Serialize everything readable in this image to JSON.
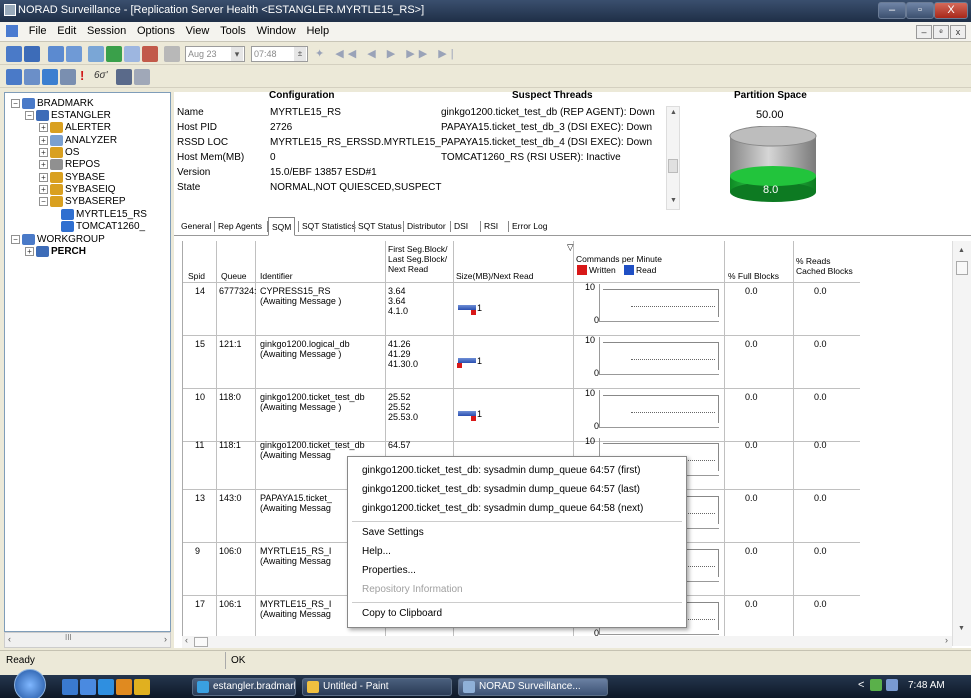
{
  "window": {
    "title": "NORAD Surveillance - [Replication Server Health <ESTANGLER.MYRTLE15_RS>]",
    "min": "–",
    "max": "▫",
    "close": "X"
  },
  "menu": {
    "items": [
      "File",
      "Edit",
      "Session",
      "Options",
      "View",
      "Tools",
      "Window",
      "Help"
    ],
    "mdi_buttons": [
      "–",
      "ᵉ",
      "x"
    ]
  },
  "toolbar": {
    "date": "Aug 23",
    "time": "07:48"
  },
  "tree": {
    "items": [
      {
        "label": "BRADMARK",
        "exp": "−"
      },
      {
        "label": "ESTANGLER",
        "exp": "−"
      },
      {
        "label": "ALERTER",
        "exp": "+"
      },
      {
        "label": "ANALYZER",
        "exp": "+"
      },
      {
        "label": "OS",
        "exp": "+"
      },
      {
        "label": "REPOS",
        "exp": "+"
      },
      {
        "label": "SYBASE",
        "exp": "+"
      },
      {
        "label": "SYBASEIQ",
        "exp": "+"
      },
      {
        "label": "SYBASEREP",
        "exp": "−"
      },
      {
        "label": "MYRTLE15_RS",
        "exp": ""
      },
      {
        "label": "TOMCAT1260_",
        "exp": ""
      },
      {
        "label": "WORKGROUP",
        "exp": "−"
      },
      {
        "label": "PERCH",
        "exp": "+"
      }
    ],
    "scroll": "III"
  },
  "config": {
    "header": "Configuration",
    "rows": [
      {
        "label": "Name",
        "value": "MYRTLE15_RS"
      },
      {
        "label": "Host PID",
        "value": "2726"
      },
      {
        "label": "RSSD LOC",
        "value": "MYRTLE15_RS_ERSSD.MYRTLE15_"
      },
      {
        "label": "Host Mem(MB)",
        "value": "0"
      },
      {
        "label": "Version",
        "value": "15.0/EBF 13857 ESD#1"
      },
      {
        "label": "State",
        "value": "NORMAL,NOT QUIESCED,SUSPECT"
      }
    ]
  },
  "suspect": {
    "header": "Suspect Threads",
    "rows": [
      "ginkgo1200.ticket_test_db (REP AGENT): Down",
      "PAPAYA15.ticket_test_db_3 (DSI EXEC): Down",
      "PAPAYA15.ticket_test_db_4 (DSI EXEC): Down",
      "TOMCAT1260_RS (RSI USER): Inactive"
    ]
  },
  "partition": {
    "header": "Partition Space",
    "total": "50.00",
    "used": "8.0"
  },
  "tabs": [
    "General",
    "Rep Agents",
    "SQM",
    "SQT Statistics",
    "SQT Status",
    "Distributor",
    "DSI",
    "RSI",
    "Error Log"
  ],
  "active_tab": "SQM",
  "grid": {
    "headers": {
      "spid": "Spid",
      "queue": "Queue",
      "identifier": "Identifier",
      "seg1": "First Seg.Block/",
      "seg2": "Last Seg.Block/",
      "seg3": "Next Read",
      "size": "Size(MB)/Next Read",
      "cpm": "Commands per Minute",
      "written": "Written",
      "read": "Read",
      "full": "% Full Blocks",
      "reads1": "% Reads",
      "reads2": "Cached Blocks"
    },
    "rows": [
      {
        "spid": "14",
        "queue": "6777324:",
        "ident": "CYPRESS15_RS",
        "status": "(Awaiting Message    )",
        "s1": "3.64",
        "s2": "3.64",
        "s3": "4.1.0",
        "size": "1",
        "tick": "10",
        "zero": "0",
        "full": "0.0",
        "reads": "0.0"
      },
      {
        "spid": "15",
        "queue": "121:1",
        "ident": "ginkgo1200.logical_db",
        "status": "(Awaiting Message    )",
        "s1": "41.26",
        "s2": "41.29",
        "s3": "41.30.0",
        "size": "1",
        "tick": "10",
        "zero": "0",
        "full": "0.0",
        "reads": "0.0"
      },
      {
        "spid": "10",
        "queue": "118:0",
        "ident": "ginkgo1200.ticket_test_db",
        "status": "(Awaiting Message    )",
        "s1": "25.52",
        "s2": "25.52",
        "s3": "25.53.0",
        "size": "1",
        "tick": "10",
        "zero": "0",
        "full": "0.0",
        "reads": "0.0"
      },
      {
        "spid": "11",
        "queue": "118:1",
        "ident": "ginkgo1200.ticket_test_db",
        "status": "(Awaiting Messag",
        "s1": "64.57",
        "s2": "",
        "s3": "",
        "size": "",
        "tick": "10",
        "zero": "0",
        "full": "0.0",
        "reads": "0.0"
      },
      {
        "spid": "13",
        "queue": "143:0",
        "ident": "PAPAYA15.ticket_",
        "status": "(Awaiting Messag",
        "s1": "",
        "s2": "",
        "s3": "",
        "size": "",
        "tick": "10",
        "zero": "0",
        "full": "0.0",
        "reads": "0.0"
      },
      {
        "spid": "9",
        "queue": "106:0",
        "ident": "MYRTLE15_RS_I",
        "status": "(Awaiting Messag",
        "s1": "",
        "s2": "",
        "s3": "",
        "size": "",
        "tick": "10",
        "zero": "0",
        "full": "0.0",
        "reads": "0.0"
      },
      {
        "spid": "17",
        "queue": "106:1",
        "ident": "MYRTLE15_RS_I",
        "status": "(Awaiting Messag",
        "s1": "",
        "s2": "",
        "s3": "",
        "size": "",
        "tick": "10",
        "zero": "0",
        "full": "0.0",
        "reads": "0.0"
      }
    ]
  },
  "context_menu": {
    "items": [
      "ginkgo1200.ticket_test_db: sysadmin dump_queue 64:57 (first)",
      "ginkgo1200.ticket_test_db: sysadmin dump_queue 64:57 (last)",
      "ginkgo1200.ticket_test_db: sysadmin dump_queue 64:58 (next)",
      "Save Settings",
      "Help...",
      "Properties...",
      "Repository Information",
      "Copy to Clipboard"
    ]
  },
  "status": {
    "left": "Ready",
    "ok": "OK"
  },
  "taskbar": {
    "items": [
      "estangler.bradmark....",
      "Untitled - Paint",
      "NORAD Surveillance..."
    ],
    "time": "7:48 AM",
    "tray": "<"
  },
  "colors": {
    "written": "#d81818",
    "read": "#1f4fc4",
    "cyl_green": "#1fbf3a"
  }
}
